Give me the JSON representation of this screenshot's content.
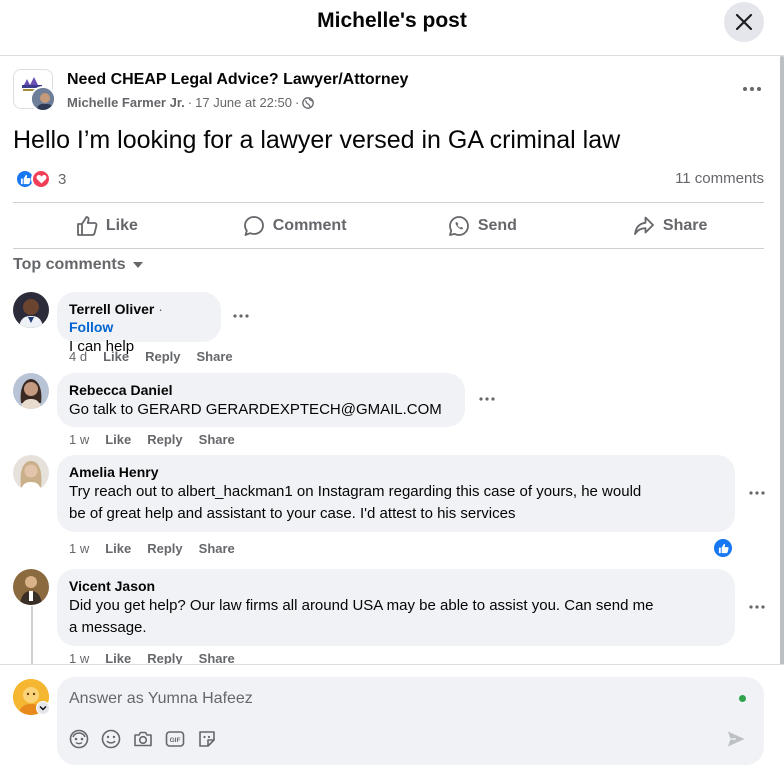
{
  "header": {
    "title": "Michelle's post"
  },
  "post": {
    "group_name": "Need CHEAP Legal Advice? Lawyer/Attorney",
    "author": "Michelle Farmer Jr.",
    "timestamp": "17 June at 22:50",
    "separator": "·",
    "text": "Hello I’m looking for a lawyer versed in GA criminal law",
    "reaction_count": "3",
    "comments_count": "11 comments"
  },
  "actions": {
    "like": "Like",
    "comment": "Comment",
    "send": "Send",
    "share": "Share"
  },
  "filter": {
    "label": "Top comments"
  },
  "comments": [
    {
      "name": "Terrell Oliver",
      "follow": "Follow",
      "text": "I can help",
      "time": "4 d",
      "like": "Like",
      "reply": "Reply",
      "share": "Share"
    },
    {
      "name": "Rebecca Daniel",
      "text": "Go talk to GERARD GERARDEXPTECH@GMAIL.COM",
      "time": "1 w",
      "like": "Like",
      "reply": "Reply",
      "share": "Share"
    },
    {
      "name": "Amelia Henry",
      "text_line1": "Try reach out to albert_hackman1 on Instagram regarding this case of yours, he would",
      "text_line2": "be of great help and assistant to your case. I'd attest to his services",
      "time": "1 w",
      "like": "Like",
      "reply": "Reply",
      "share": "Share"
    },
    {
      "name": "Vicent Jason",
      "text_line1": "Did you get help? Our law firms all around USA may be able to assist you. Can send me",
      "text_line2": "a message.",
      "time": "1 w",
      "like": "Like",
      "reply": "Reply",
      "share": "Share"
    }
  ],
  "composer": {
    "placeholder": "Answer as Yumna Hafeez"
  },
  "colors": {
    "accent": "#1877f2",
    "love": "#f33e58",
    "secondary_text": "#65676b",
    "bubble": "#f0f2f5",
    "online": "#31a24c"
  }
}
